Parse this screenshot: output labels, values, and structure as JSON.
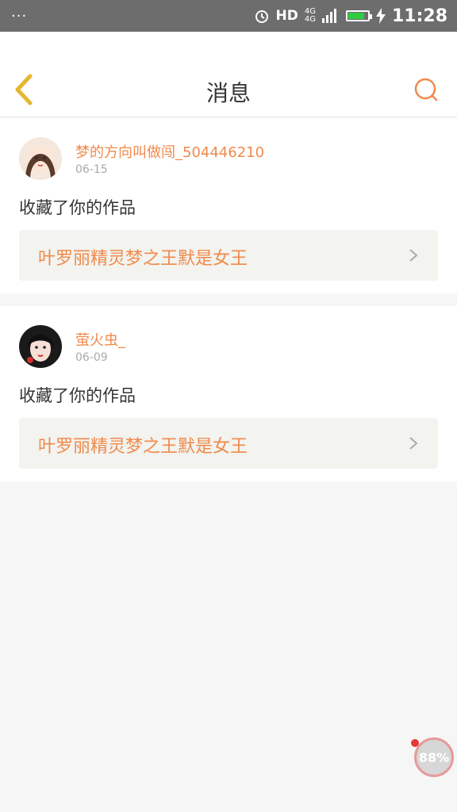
{
  "status_bar": {
    "notifications": "···",
    "network_label": "HD",
    "net_top": "4G",
    "net_bottom": "4G",
    "time": "11:28",
    "battery_level": 0.85
  },
  "header": {
    "title": "消息",
    "back_icon": "chevron-left-icon",
    "search_icon": "search-icon"
  },
  "messages": [
    {
      "username": "梦的方向叫做闯_504446210",
      "date": "06-15",
      "action": "收藏了你的作品",
      "work_title": "叶罗丽精灵梦之王默是女王"
    },
    {
      "username": "萤火虫_",
      "date": "06-09",
      "action": "收藏了你的作品",
      "work_title": "叶罗丽精灵梦之王默是女王"
    }
  ],
  "floating_badge": {
    "label": "88%"
  },
  "colors": {
    "accent": "#f08a4b",
    "back_icon": "#e5b730",
    "status_bar": "#6d6d6d"
  }
}
